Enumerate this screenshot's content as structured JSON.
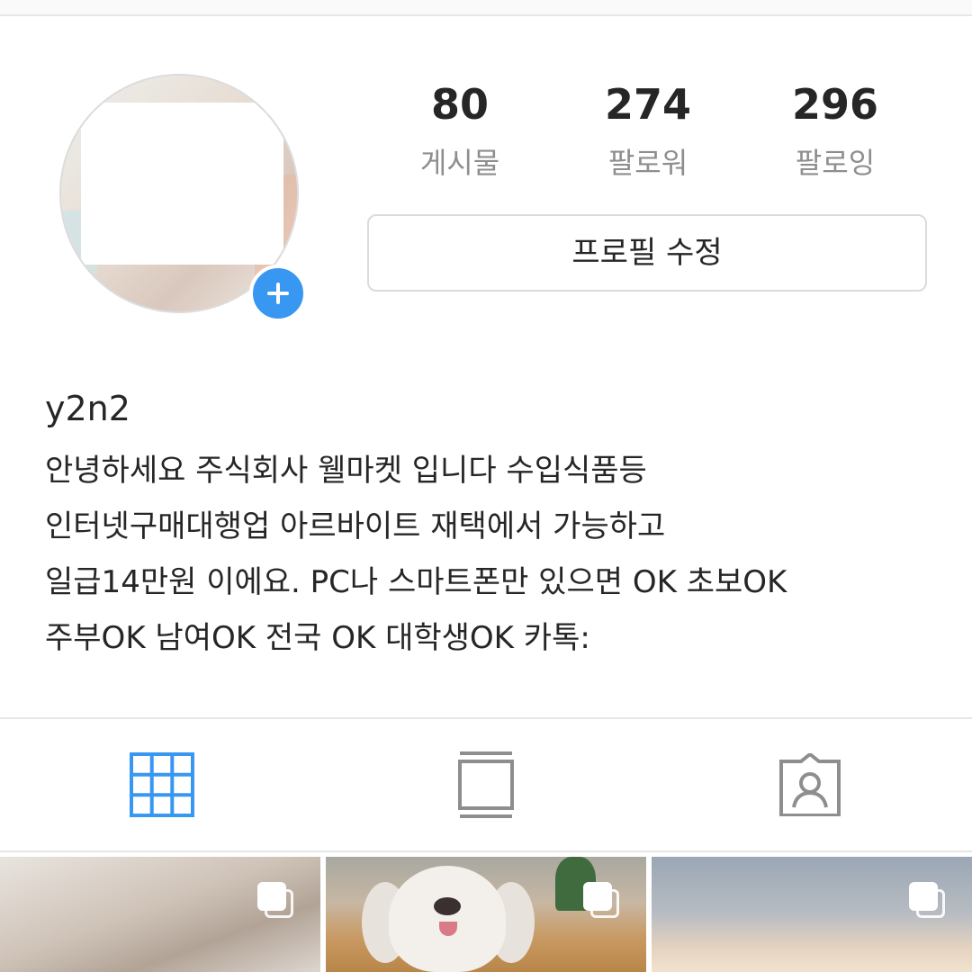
{
  "profile": {
    "username": "y2n2",
    "stats": {
      "posts": {
        "count": "80",
        "label": "게시물"
      },
      "followers": {
        "count": "274",
        "label": "팔로워"
      },
      "following": {
        "count": "296",
        "label": "팔로잉"
      }
    },
    "edit_profile_label": "프로필 수정",
    "bio_lines": [
      "안녕하세요 주식회사 웰마켓 입니다 수입식품등",
      "인터넷구매대행업 아르바이트 재택에서 가능하고",
      "일급14만원 이에요. PC나 스마트폰만 있으면 OK 초보OK",
      "주부OK 남여OK 전국 OK 대학생OK 카톡:"
    ]
  },
  "tabs": [
    {
      "icon": "grid-icon",
      "active": true
    },
    {
      "icon": "feed-icon",
      "active": false
    },
    {
      "icon": "tagged-icon",
      "active": false
    }
  ],
  "colors": {
    "accent": "#3897f0",
    "icon_inactive": "#8e8e8e",
    "text": "#262626",
    "muted": "#8e8e8e",
    "divider": "#e6e6e6"
  },
  "posts_preview": [
    {
      "icon": "multiple-photos-icon"
    },
    {
      "icon": "multiple-photos-icon"
    },
    {
      "icon": "multiple-photos-icon"
    }
  ]
}
